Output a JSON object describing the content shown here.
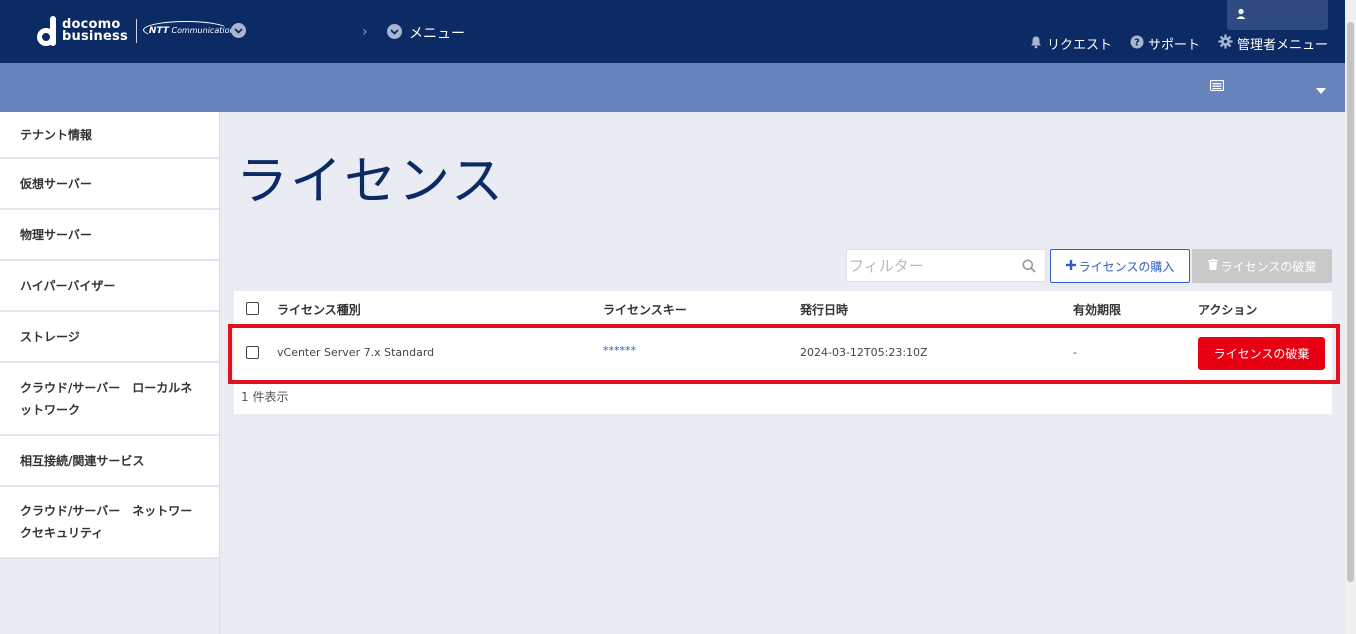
{
  "header": {
    "logo_line1": "docomo",
    "logo_line2": "business",
    "ntt_brand": "NTT",
    "ntt_sub": "Communications",
    "breadcrumb_menu": "メニュー",
    "links": {
      "request": "リクエスト",
      "support": "サポート",
      "admin_menu": "管理者メニュー"
    }
  },
  "sidebar": {
    "items": [
      "テナント情報",
      "仮想サーバー",
      "物理サーバー",
      "ハイパーバイザー",
      "ストレージ",
      "クラウド/サーバー　ローカルネットワーク",
      "相互接続/関連サービス",
      "クラウド/サーバー　ネットワークセキュリティ"
    ]
  },
  "main": {
    "title": "ライセンス",
    "filter_placeholder": "フィルター",
    "buy_button": "ライセンスの購入",
    "discard_button_top": "ライセンスの破棄",
    "table": {
      "columns": {
        "type": "ライセンス種別",
        "key": "ライセンスキー",
        "issued": "発行日時",
        "expiry": "有効期限",
        "action": "アクション"
      },
      "rows": [
        {
          "type": "vCenter Server 7.x Standard",
          "key": "******",
          "issued": "2024-03-12T05:23:10Z",
          "expiry": "-",
          "action": "ライセンスの破棄"
        }
      ],
      "count_text": "1 件表示"
    }
  },
  "colors": {
    "header_bg": "#0c2a63",
    "subbar_bg": "#6884bd",
    "accent_blue": "#2d5fc1",
    "danger_red": "#e60012",
    "highlight_red": "#e0101c"
  }
}
